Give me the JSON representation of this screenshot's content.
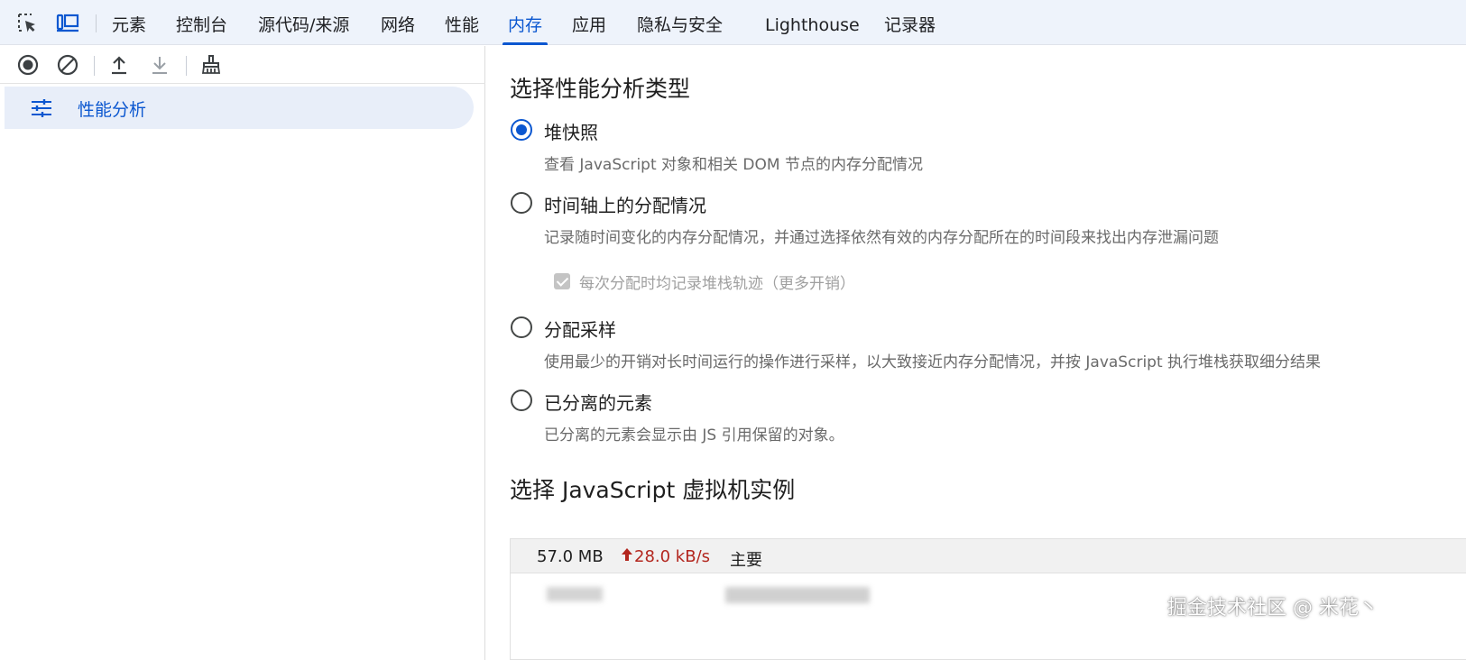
{
  "tabs": {
    "inspect_icon": "inspect-element-icon",
    "device_icon": "device-toolbar-icon",
    "items": [
      {
        "label": "元素"
      },
      {
        "label": "控制台"
      },
      {
        "label": "源代码/来源"
      },
      {
        "label": "网络"
      },
      {
        "label": "性能"
      },
      {
        "label": "内存",
        "active": true
      },
      {
        "label": "应用"
      },
      {
        "label": "隐私与安全"
      },
      {
        "label": "Lighthouse"
      },
      {
        "label": "记录器"
      }
    ]
  },
  "toolbar": {
    "icons": [
      "record-icon",
      "clear-icon",
      "upload-icon",
      "download-icon",
      "garbage-collect-icon"
    ]
  },
  "sidebar": {
    "item_label": "性能分析",
    "item_icon": "sliders-icon"
  },
  "main": {
    "section_title": "选择性能分析类型",
    "options": [
      {
        "label": "堆快照",
        "desc": "查看 JavaScript 对象和相关 DOM 节点的内存分配情况",
        "checked": true
      },
      {
        "label": "时间轴上的分配情况",
        "desc": "记录随时间变化的内存分配情况，并通过选择依然有效的内存分配所在的时间段来找出内存泄漏问题",
        "checked": false
      },
      {
        "label": "分配采样",
        "desc": "使用最少的开销对长时间运行的操作进行采样，以大致接近内存分配情况，并按 JavaScript 执行堆栈获取细分结果",
        "checked": false
      },
      {
        "label": "已分离的元素",
        "desc": "已分离的元素会显示由 JS 引用保留的对象。",
        "checked": false
      }
    ],
    "sub_option_label": "每次分配时均记录堆栈轨迹（更多开销）",
    "vm_title": "选择 JavaScript 虚拟机实例",
    "vm": {
      "size": "57.0 MB",
      "rate": "28.0 kB/s",
      "name": "主要"
    }
  },
  "watermark": "掘金技术社区 @ 米花丶",
  "colors": {
    "accent": "#0b57d0",
    "tabbar_bg": "#eef3fb",
    "rate_red": "#b3261e"
  }
}
